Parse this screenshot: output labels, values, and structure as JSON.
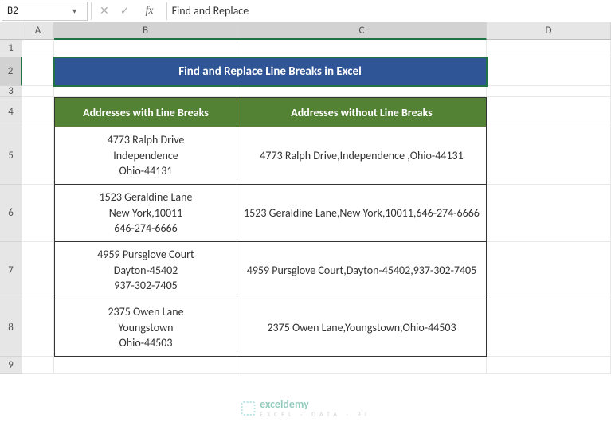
{
  "formula_bar": {
    "namebox_value": "B2",
    "formula_value": "Find and Replace"
  },
  "columns": [
    "A",
    "B",
    "C",
    "D"
  ],
  "rows": [
    "1",
    "2",
    "3",
    "4",
    "5",
    "6",
    "7",
    "8",
    "9"
  ],
  "title": "Find and Replace Line Breaks in Excel",
  "table": {
    "headers": {
      "left": "Addresses with Line Breaks",
      "right": "Addresses without Line Breaks"
    },
    "rows": [
      {
        "with": "4773 Ralph Drive\nIndependence\nOhio-44131",
        "without": "4773 Ralph Drive,Independence ,Ohio-44131"
      },
      {
        "with": "1523 Geraldine Lane\nNew York,10011\n646-274-6666",
        "without": "1523 Geraldine Lane,New York,10011,646-274-6666"
      },
      {
        "with": "4959 Pursglove Court\nDayton-45402\n937-302-7405",
        "without": "4959 Pursglove Court,Dayton-45402,937-302-7405"
      },
      {
        "with": "2375 Owen Lane\nYoungstown\nOhio-44503",
        "without": "2375 Owen Lane,Youngstown,Ohio-44503"
      }
    ]
  },
  "watermark": {
    "brand": "exceldemy",
    "subtitle": "EXCEL · DATA · BI"
  }
}
